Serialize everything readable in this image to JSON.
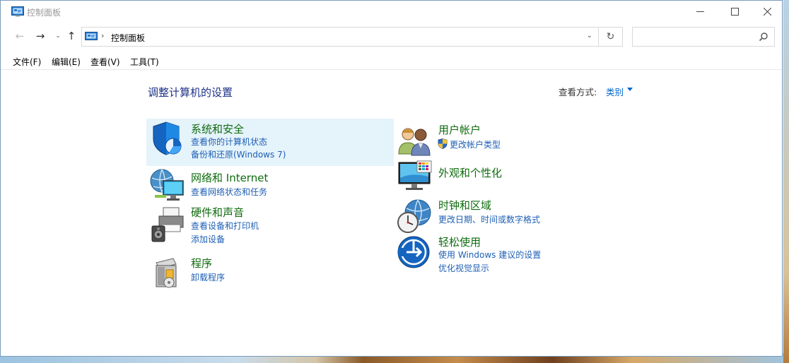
{
  "window": {
    "title": "控制面板",
    "minimize_glyph": "─",
    "maximize_glyph": "☐",
    "close_glyph": "✕"
  },
  "nav": {
    "back_glyph": "←",
    "forward_glyph": "→",
    "recent_glyph": "⌄",
    "up_glyph": "↑",
    "address_separator": "›",
    "address_text": "控制面板",
    "address_dropdown_glyph": "⌄",
    "refresh_glyph": "↻",
    "search_placeholder": ""
  },
  "menu": {
    "file": "文件(F)",
    "edit": "编辑(E)",
    "view": "查看(V)",
    "tools": "工具(T)"
  },
  "content": {
    "page_title": "调整计算机的设置",
    "viewby_label": "查看方式:",
    "viewby_value": "类别"
  },
  "categories": {
    "system": {
      "title": "系统和安全",
      "links": [
        "查看你的计算机状态",
        "备份和还原(Windows 7)"
      ],
      "icon": "shield-pie-icon",
      "highlighted": true
    },
    "network": {
      "title": "网络和 Internet",
      "links": [
        "查看网络状态和任务"
      ],
      "icon": "globe-monitor-icon"
    },
    "hardware": {
      "title": "硬件和声音",
      "links": [
        "查看设备和打印机",
        "添加设备"
      ],
      "icon": "printer-speaker-icon"
    },
    "programs": {
      "title": "程序",
      "links": [
        "卸载程序"
      ],
      "icon": "program-box-icon"
    },
    "users": {
      "title": "用户帐户",
      "links": [
        "更改帐户类型"
      ],
      "icon": "users-icon"
    },
    "appearance": {
      "title": "外观和个性化",
      "links": [],
      "icon": "monitor-palette-icon"
    },
    "clock": {
      "title": "时钟和区域",
      "links": [
        "更改日期、时间或数字格式"
      ],
      "icon": "clock-globe-icon"
    },
    "ease": {
      "title": "轻松使用",
      "links": [
        "使用 Windows 建议的设置",
        "优化视觉显示"
      ],
      "icon": "ease-of-access-icon"
    }
  },
  "colors": {
    "category_title": "#0e6b0e",
    "link": "#1e5fb4",
    "page_title": "#1e3287",
    "highlight": "#e5f3fb"
  }
}
